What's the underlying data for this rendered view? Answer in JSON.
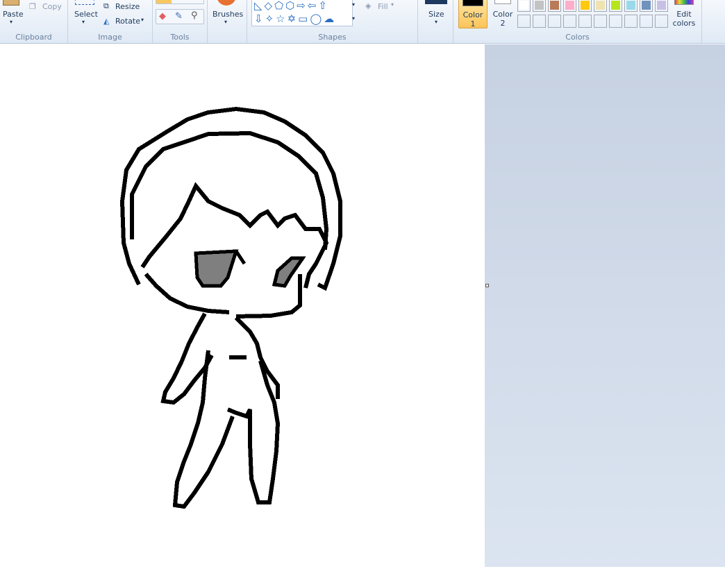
{
  "ribbon": {
    "clipboard": {
      "paste": "Paste",
      "copy": "Copy",
      "group": "Clipboard"
    },
    "image": {
      "select": "Select",
      "resize": "Resize",
      "rotate": "Rotate",
      "group": "Image"
    },
    "tools": {
      "group": "Tools",
      "icons": [
        "eraser-icon",
        "color-picker-icon",
        "magnifier-icon"
      ]
    },
    "brushes": {
      "label": "Brushes"
    },
    "shapes": {
      "group": "Shapes",
      "fill": "Fill"
    },
    "size": {
      "label": "Size"
    },
    "colors": {
      "color1": "Color",
      "color1_num": "1",
      "color2": "Color",
      "color2_num": "2",
      "edit": "Edit",
      "edit2": "colors",
      "group": "Colors",
      "color1_value": "#000000",
      "color2_value": "#ffffff",
      "palette": [
        "#ffffff",
        "#c3c3c3",
        "#b97a57",
        "#ffaec9",
        "#ffc90e",
        "#efe4b0",
        "#b5e61d",
        "#99d9ea",
        "#7092be",
        "#c8bfe7"
      ]
    }
  }
}
